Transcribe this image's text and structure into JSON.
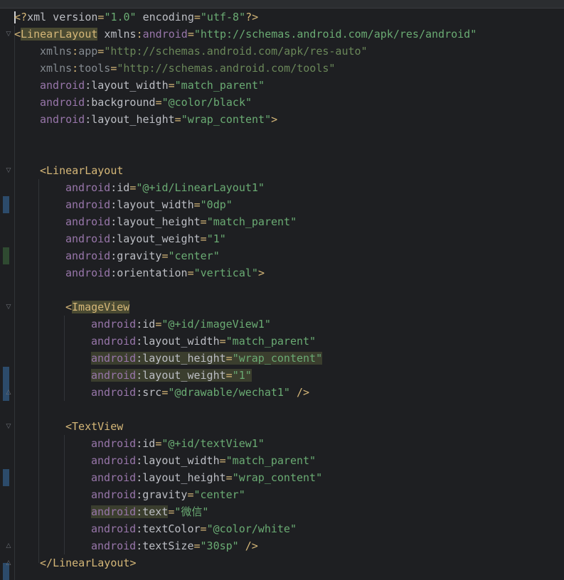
{
  "lines": [
    {
      "parts": [
        [
          "p",
          "<?"
        ],
        [
          "attr",
          "xml version"
        ],
        [
          "p",
          "="
        ],
        [
          "str",
          "\"1.0\""
        ],
        [
          "attr",
          " encoding"
        ],
        [
          "p",
          "="
        ],
        [
          "str",
          "\"utf-8\""
        ],
        [
          "p",
          "?>"
        ]
      ]
    },
    {
      "parts": [
        [
          "p",
          "<"
        ],
        [
          "taghl",
          "LinearLayout"
        ],
        [
          "attr",
          " xmlns"
        ],
        [
          "p",
          ":"
        ],
        [
          "ns",
          "android"
        ],
        [
          "p",
          "="
        ],
        [
          "str",
          "\"http://schemas.android.com/apk/res/android\""
        ]
      ]
    },
    {
      "dim": true,
      "parts": [
        [
          "attr",
          "xmlns"
        ],
        [
          "p",
          ":"
        ],
        [
          "attr",
          "app"
        ],
        [
          "p",
          "="
        ],
        [
          "str",
          "\"http://schemas.android.com/apk/res-auto\""
        ]
      ]
    },
    {
      "dim": true,
      "parts": [
        [
          "attr",
          "xmlns"
        ],
        [
          "p",
          ":"
        ],
        [
          "attr",
          "tools"
        ],
        [
          "p",
          "="
        ],
        [
          "str",
          "\"http://schemas.android.com/tools\""
        ]
      ]
    },
    {
      "parts": [
        [
          "ns",
          "android"
        ],
        [
          "attr",
          ":layout_width"
        ],
        [
          "p",
          "="
        ],
        [
          "str",
          "\"match_parent\""
        ]
      ]
    },
    {
      "parts": [
        [
          "ns",
          "android"
        ],
        [
          "attr",
          ":background"
        ],
        [
          "p",
          "="
        ],
        [
          "str",
          "\"@color/black\""
        ]
      ]
    },
    {
      "parts": [
        [
          "ns",
          "android"
        ],
        [
          "attr",
          ":layout_height"
        ],
        [
          "p",
          "="
        ],
        [
          "str",
          "\"wrap_content\""
        ],
        [
          "p",
          ">"
        ]
      ]
    },
    {
      "parts": []
    },
    {
      "parts": []
    },
    {
      "parts": [
        [
          "p",
          "<"
        ],
        [
          "tag",
          "LinearLayout"
        ]
      ]
    },
    {
      "parts": [
        [
          "ns",
          "android"
        ],
        [
          "attr",
          ":id"
        ],
        [
          "p",
          "="
        ],
        [
          "str",
          "\"@+id/LinearLayout1\""
        ]
      ]
    },
    {
      "parts": [
        [
          "ns",
          "android"
        ],
        [
          "attr",
          ":layout_width"
        ],
        [
          "p",
          "="
        ],
        [
          "str",
          "\"0dp\""
        ]
      ]
    },
    {
      "parts": [
        [
          "ns",
          "android"
        ],
        [
          "attr",
          ":layout_height"
        ],
        [
          "p",
          "="
        ],
        [
          "str",
          "\"match_parent\""
        ]
      ]
    },
    {
      "parts": [
        [
          "ns",
          "android"
        ],
        [
          "attr",
          ":layout_weight"
        ],
        [
          "p",
          "="
        ],
        [
          "str",
          "\"1\""
        ]
      ]
    },
    {
      "parts": [
        [
          "ns",
          "android"
        ],
        [
          "attr",
          ":gravity"
        ],
        [
          "p",
          "="
        ],
        [
          "str",
          "\"center\""
        ]
      ]
    },
    {
      "parts": [
        [
          "ns",
          "android"
        ],
        [
          "attr",
          ":orientation"
        ],
        [
          "p",
          "="
        ],
        [
          "str",
          "\"vertical\""
        ],
        [
          "p",
          ">"
        ]
      ]
    },
    {
      "parts": []
    },
    {
      "parts": [
        [
          "p",
          "<"
        ],
        [
          "taghl",
          "ImageView"
        ]
      ]
    },
    {
      "parts": [
        [
          "ns",
          "android"
        ],
        [
          "attr",
          ":id"
        ],
        [
          "p",
          "="
        ],
        [
          "str",
          "\"@+id/imageView1\""
        ]
      ]
    },
    {
      "parts": [
        [
          "ns",
          "android"
        ],
        [
          "attr",
          ":layout_width"
        ],
        [
          "p",
          "="
        ],
        [
          "str",
          "\"match_parent\""
        ]
      ]
    },
    {
      "hl": true,
      "parts": [
        [
          "ns",
          "android"
        ],
        [
          "attr",
          ":layout_height"
        ],
        [
          "p",
          "="
        ],
        [
          "str",
          "\"wrap_content\""
        ]
      ]
    },
    {
      "hl": true,
      "parts": [
        [
          "ns",
          "android"
        ],
        [
          "attr",
          ":layout_weight"
        ],
        [
          "p",
          "="
        ],
        [
          "str",
          "\"1\""
        ]
      ]
    },
    {
      "parts": [
        [
          "ns",
          "android"
        ],
        [
          "attr",
          ":src"
        ],
        [
          "p",
          "="
        ],
        [
          "str",
          "\"@drawable/wechat1\""
        ],
        [
          "p",
          " />"
        ]
      ]
    },
    {
      "parts": []
    },
    {
      "parts": [
        [
          "p",
          "<"
        ],
        [
          "tag",
          "TextView"
        ]
      ]
    },
    {
      "parts": [
        [
          "ns",
          "android"
        ],
        [
          "attr",
          ":id"
        ],
        [
          "p",
          "="
        ],
        [
          "str",
          "\"@+id/textView1\""
        ]
      ]
    },
    {
      "parts": [
        [
          "ns",
          "android"
        ],
        [
          "attr",
          ":layout_width"
        ],
        [
          "p",
          "="
        ],
        [
          "str",
          "\"match_parent\""
        ]
      ]
    },
    {
      "parts": [
        [
          "ns",
          "android"
        ],
        [
          "attr",
          ":layout_height"
        ],
        [
          "p",
          "="
        ],
        [
          "str",
          "\"wrap_content\""
        ]
      ]
    },
    {
      "parts": [
        [
          "ns",
          "android"
        ],
        [
          "attr",
          ":gravity"
        ],
        [
          "p",
          "="
        ],
        [
          "str",
          "\"center\""
        ]
      ]
    },
    {
      "hlpart": true,
      "parts": [
        [
          "ns",
          "android"
        ],
        [
          "attr",
          ":text"
        ],
        [
          "p",
          "="
        ],
        [
          "str",
          "\"微信\""
        ]
      ]
    },
    {
      "parts": [
        [
          "ns",
          "android"
        ],
        [
          "attr",
          ":textColor"
        ],
        [
          "p",
          "="
        ],
        [
          "str",
          "\"@color/white\""
        ]
      ]
    },
    {
      "parts": [
        [
          "ns",
          "android"
        ],
        [
          "attr",
          ":textSize"
        ],
        [
          "p",
          "="
        ],
        [
          "str",
          "\"30sp\""
        ],
        [
          "p",
          " />"
        ]
      ]
    },
    {
      "parts": [
        [
          "p",
          "</"
        ],
        [
          "tag",
          "LinearLayout"
        ],
        [
          "p",
          ">"
        ]
      ]
    }
  ],
  "colors": {
    "background": "#1e1f22",
    "tag": "#d5b778",
    "namespace": "#9876aa",
    "attribute": "#bcbec4",
    "string": "#6aab73"
  },
  "gutter_icons": [
    "fold-open-icon",
    "fold-close-icon",
    "change-marker-icon"
  ]
}
